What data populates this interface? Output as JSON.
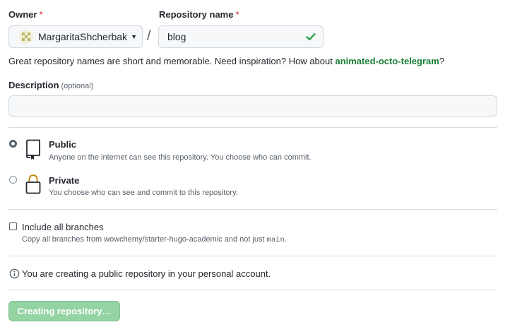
{
  "owner": {
    "label": "Owner",
    "required_mark": "*",
    "value": "MargaritaShcherbak",
    "avatar_icon": "avatar-identicon"
  },
  "separator": "/",
  "repository": {
    "label": "Repository name",
    "required_mark": "*",
    "value": "blog",
    "status_icon": "check-icon",
    "status_color": "#2da44e"
  },
  "hint": {
    "text": "Great repository names are short and memorable. Need inspiration? How about ",
    "suggestion": "animated-octo-telegram",
    "suffix": "?"
  },
  "description": {
    "label": "Description",
    "optional": "(optional)",
    "value": ""
  },
  "visibility": {
    "selected": "public",
    "options": [
      {
        "id": "public",
        "title": "Public",
        "subtitle": "Anyone on the internet can see this repository. You choose who can commit.",
        "icon": "repo-icon"
      },
      {
        "id": "private",
        "title": "Private",
        "subtitle": "You choose who can see and commit to this repository.",
        "icon": "lock-icon"
      }
    ]
  },
  "branches": {
    "label": "Include all branches",
    "checked": false,
    "hint_prefix": "Copy all branches from wowchemy/starter-hugo-academic and not just ",
    "hint_code": "main",
    "hint_suffix": "."
  },
  "notice": {
    "icon": "info-icon",
    "text": "You are creating a public repository in your personal account."
  },
  "submit": {
    "label": "Creating repository…",
    "disabled": true,
    "color": "#94d3a2"
  }
}
